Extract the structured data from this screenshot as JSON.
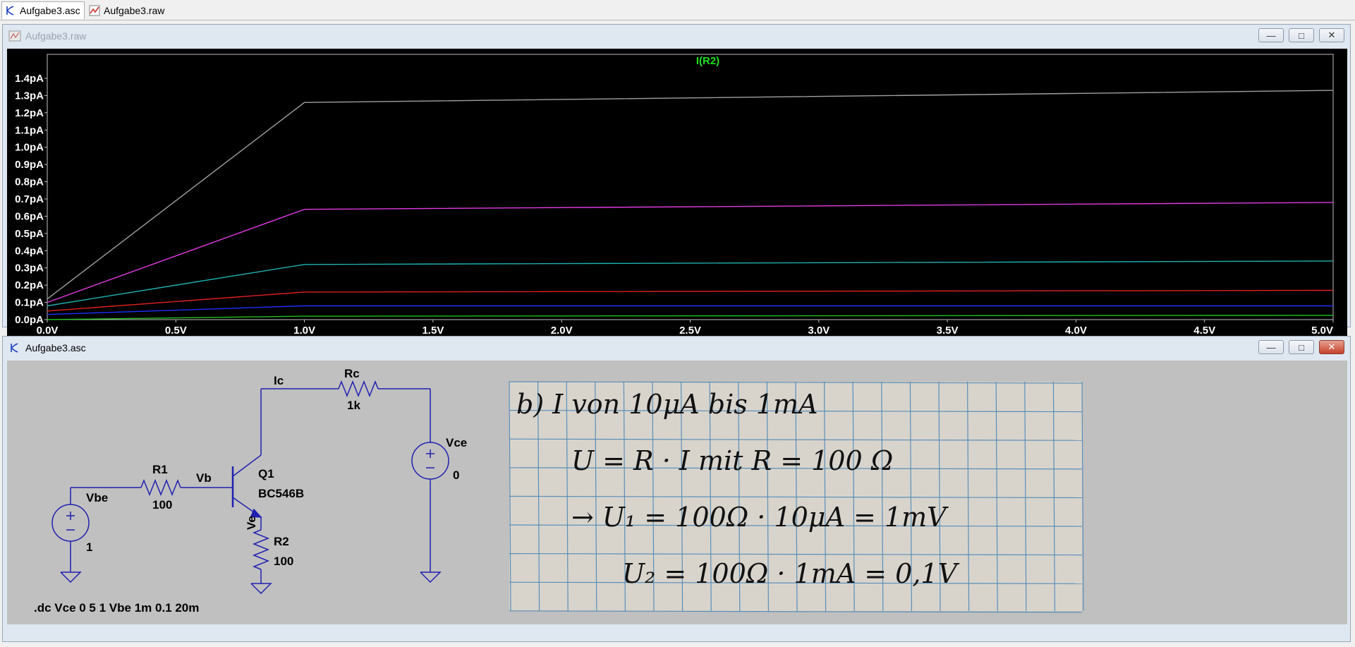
{
  "tabs": [
    {
      "label": "Aufgabe3.asc",
      "icon": "schematic-icon"
    },
    {
      "label": "Aufgabe3.raw",
      "icon": "waveform-icon"
    }
  ],
  "plot_window": {
    "title": "Aufgabe3.raw",
    "controls": {
      "minimize": "minimize-icon",
      "maximize": "maximize-icon",
      "close": "close-icon"
    }
  },
  "schematic_window": {
    "title": "Aufgabe3.asc",
    "controls": {
      "minimize": "minimize-icon",
      "maximize": "maximize-icon",
      "close": "close-icon"
    }
  },
  "chart_data": {
    "type": "line",
    "title": "I(R2)",
    "xlabel": "",
    "ylabel": "",
    "x_ticks": [
      "0.0V",
      "0.5V",
      "1.0V",
      "1.5V",
      "2.0V",
      "2.5V",
      "3.0V",
      "3.5V",
      "4.0V",
      "4.5V",
      "5.0V"
    ],
    "y_ticks": [
      "0.0pA",
      "0.1pA",
      "0.2pA",
      "0.3pA",
      "0.4pA",
      "0.5pA",
      "0.6pA",
      "0.7pA",
      "0.8pA",
      "0.9pA",
      "1.0pA",
      "1.1pA",
      "1.2pA",
      "1.3pA",
      "1.4pA"
    ],
    "xlim": [
      0,
      5
    ],
    "ylim": [
      0,
      1.4
    ],
    "grid": false,
    "background": "#000000",
    "series": [
      {
        "color": "#a0a0a0",
        "points": [
          [
            0,
            0.12
          ],
          [
            1,
            1.26
          ],
          [
            5,
            1.33
          ]
        ]
      },
      {
        "color": "#e03ce0",
        "points": [
          [
            0,
            0.1
          ],
          [
            1,
            0.64
          ],
          [
            5,
            0.68
          ]
        ]
      },
      {
        "color": "#20b0b0",
        "points": [
          [
            0,
            0.08
          ],
          [
            1,
            0.32
          ],
          [
            5,
            0.34
          ]
        ]
      },
      {
        "color": "#e02020",
        "points": [
          [
            0,
            0.05
          ],
          [
            1,
            0.16
          ],
          [
            5,
            0.17
          ]
        ]
      },
      {
        "color": "#2030ff",
        "points": [
          [
            0,
            0.03
          ],
          [
            1,
            0.08
          ],
          [
            5,
            0.08
          ]
        ]
      },
      {
        "color": "#20c020",
        "points": [
          [
            0,
            0.0
          ],
          [
            1,
            0.02
          ],
          [
            5,
            0.025
          ]
        ]
      }
    ]
  },
  "schematic": {
    "labels": {
      "ic_net": "Ic",
      "rc_name": "Rc",
      "rc_value": "1k",
      "vce_name": "Vce",
      "vce_value": "0",
      "r1_name": "R1",
      "r1_value": "100",
      "vb_net": "Vb",
      "q1_name": "Q1",
      "q1_model": "BC546B",
      "ve_net": "Ve",
      "r2_name": "R2",
      "r2_value": "100",
      "vbe_name": "Vbe",
      "vbe_value": "1",
      "directive": ".dc Vce 0 5 1 Vbe 1m 0.1 20m"
    },
    "wire_color": "#2020b0",
    "note_image": {
      "lines": [
        "b)  I  von  10μA  bis  1mA",
        "U = R · I      mit   R = 100 Ω",
        "→  U₁ = 100Ω · 10μA  =  1mV",
        "U₂ = 100Ω · 1mA   =  0,1V"
      ]
    }
  }
}
